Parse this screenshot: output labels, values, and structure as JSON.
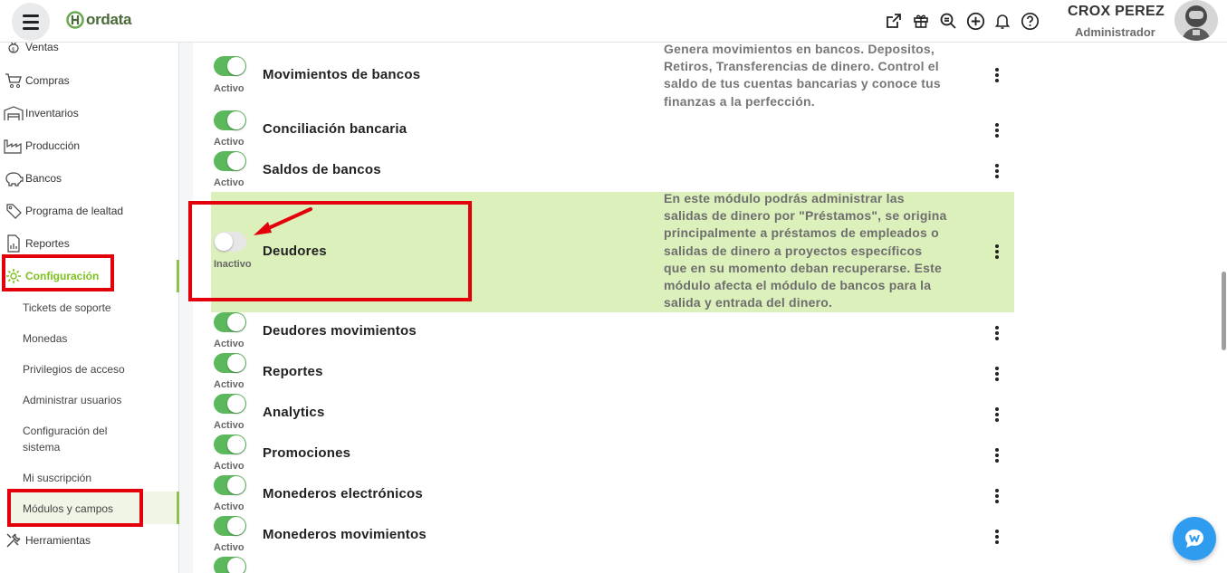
{
  "app": {
    "logo_text": "ordata"
  },
  "user": {
    "name": "CROX PEREZ",
    "role": "Administrador"
  },
  "header_icons": [
    "external-link-icon",
    "gift-icon",
    "search-zoom-icon",
    "plus-circle-icon",
    "bell-icon",
    "help-icon"
  ],
  "sidebar": {
    "items": [
      {
        "label": "Ventas",
        "icon": "money-bag-icon"
      },
      {
        "label": "Compras",
        "icon": "cart-icon"
      },
      {
        "label": "Inventarios",
        "icon": "warehouse-icon"
      },
      {
        "label": "Producción",
        "icon": "factory-icon"
      },
      {
        "label": "Bancos",
        "icon": "piggy-bank-icon"
      },
      {
        "label": "Programa de lealtad",
        "icon": "loyalty-tag-icon"
      },
      {
        "label": "Reportes",
        "icon": "report-icon"
      },
      {
        "label": "Configuración",
        "icon": "gear-icon"
      }
    ],
    "sub_items": [
      "Tickets de soporte",
      "Monedas",
      "Privilegios de acceso",
      "Administrar usuarios",
      "Configuración del",
      "sistema",
      "Mi suscripción",
      "Módulos y campos"
    ],
    "tools": {
      "label": "Herramientas",
      "icon": "tools-icon"
    }
  },
  "modules": [
    {
      "name": "Movimientos de bancos",
      "status": "Activo",
      "enabled": true,
      "desc_lines": [
        "Genera movimientos en bancos. Depositos,",
        "Retiros, Transferencias de dinero. Control el",
        "saldo de tus cuentas bancarias y conoce tus",
        "finanzas a la perfección."
      ]
    },
    {
      "name": "Conciliación bancaria",
      "status": "Activo",
      "enabled": true,
      "desc_lines": []
    },
    {
      "name": "Saldos de bancos",
      "status": "Activo",
      "enabled": true,
      "desc_lines": []
    },
    {
      "name": "Deudores",
      "status": "Inactivo",
      "enabled": false,
      "highlighted": true,
      "desc_lines": [
        "En este módulo podrás administrar las",
        "salidas de dinero por \"Préstamos\", se origina",
        "principalmente a préstamos de empleados o",
        "salidas de dinero a proyectos específicos",
        "que en su momento deban recuperarse. Este",
        "módulo afecta el módulo de bancos para la",
        "salida y entrada del dinero."
      ]
    },
    {
      "name": "Deudores movimientos",
      "status": "Activo",
      "enabled": true,
      "desc_lines": []
    },
    {
      "name": "Reportes",
      "status": "Activo",
      "enabled": true,
      "desc_lines": []
    },
    {
      "name": "Analytics",
      "status": "Activo",
      "enabled": true,
      "desc_lines": []
    },
    {
      "name": "Promociones",
      "status": "Activo",
      "enabled": true,
      "desc_lines": []
    },
    {
      "name": "Monederos electrónicos",
      "status": "Activo",
      "enabled": true,
      "desc_lines": []
    },
    {
      "name": "Monederos movimientos",
      "status": "Activo",
      "enabled": true,
      "desc_lines": []
    }
  ],
  "colors": {
    "accent": "#7cc11c",
    "toggle_on": "#5cb85c",
    "highlight_row": "#dcf0bc",
    "annotation_red": "#e3000b",
    "chat_button": "#2f9cf0"
  }
}
